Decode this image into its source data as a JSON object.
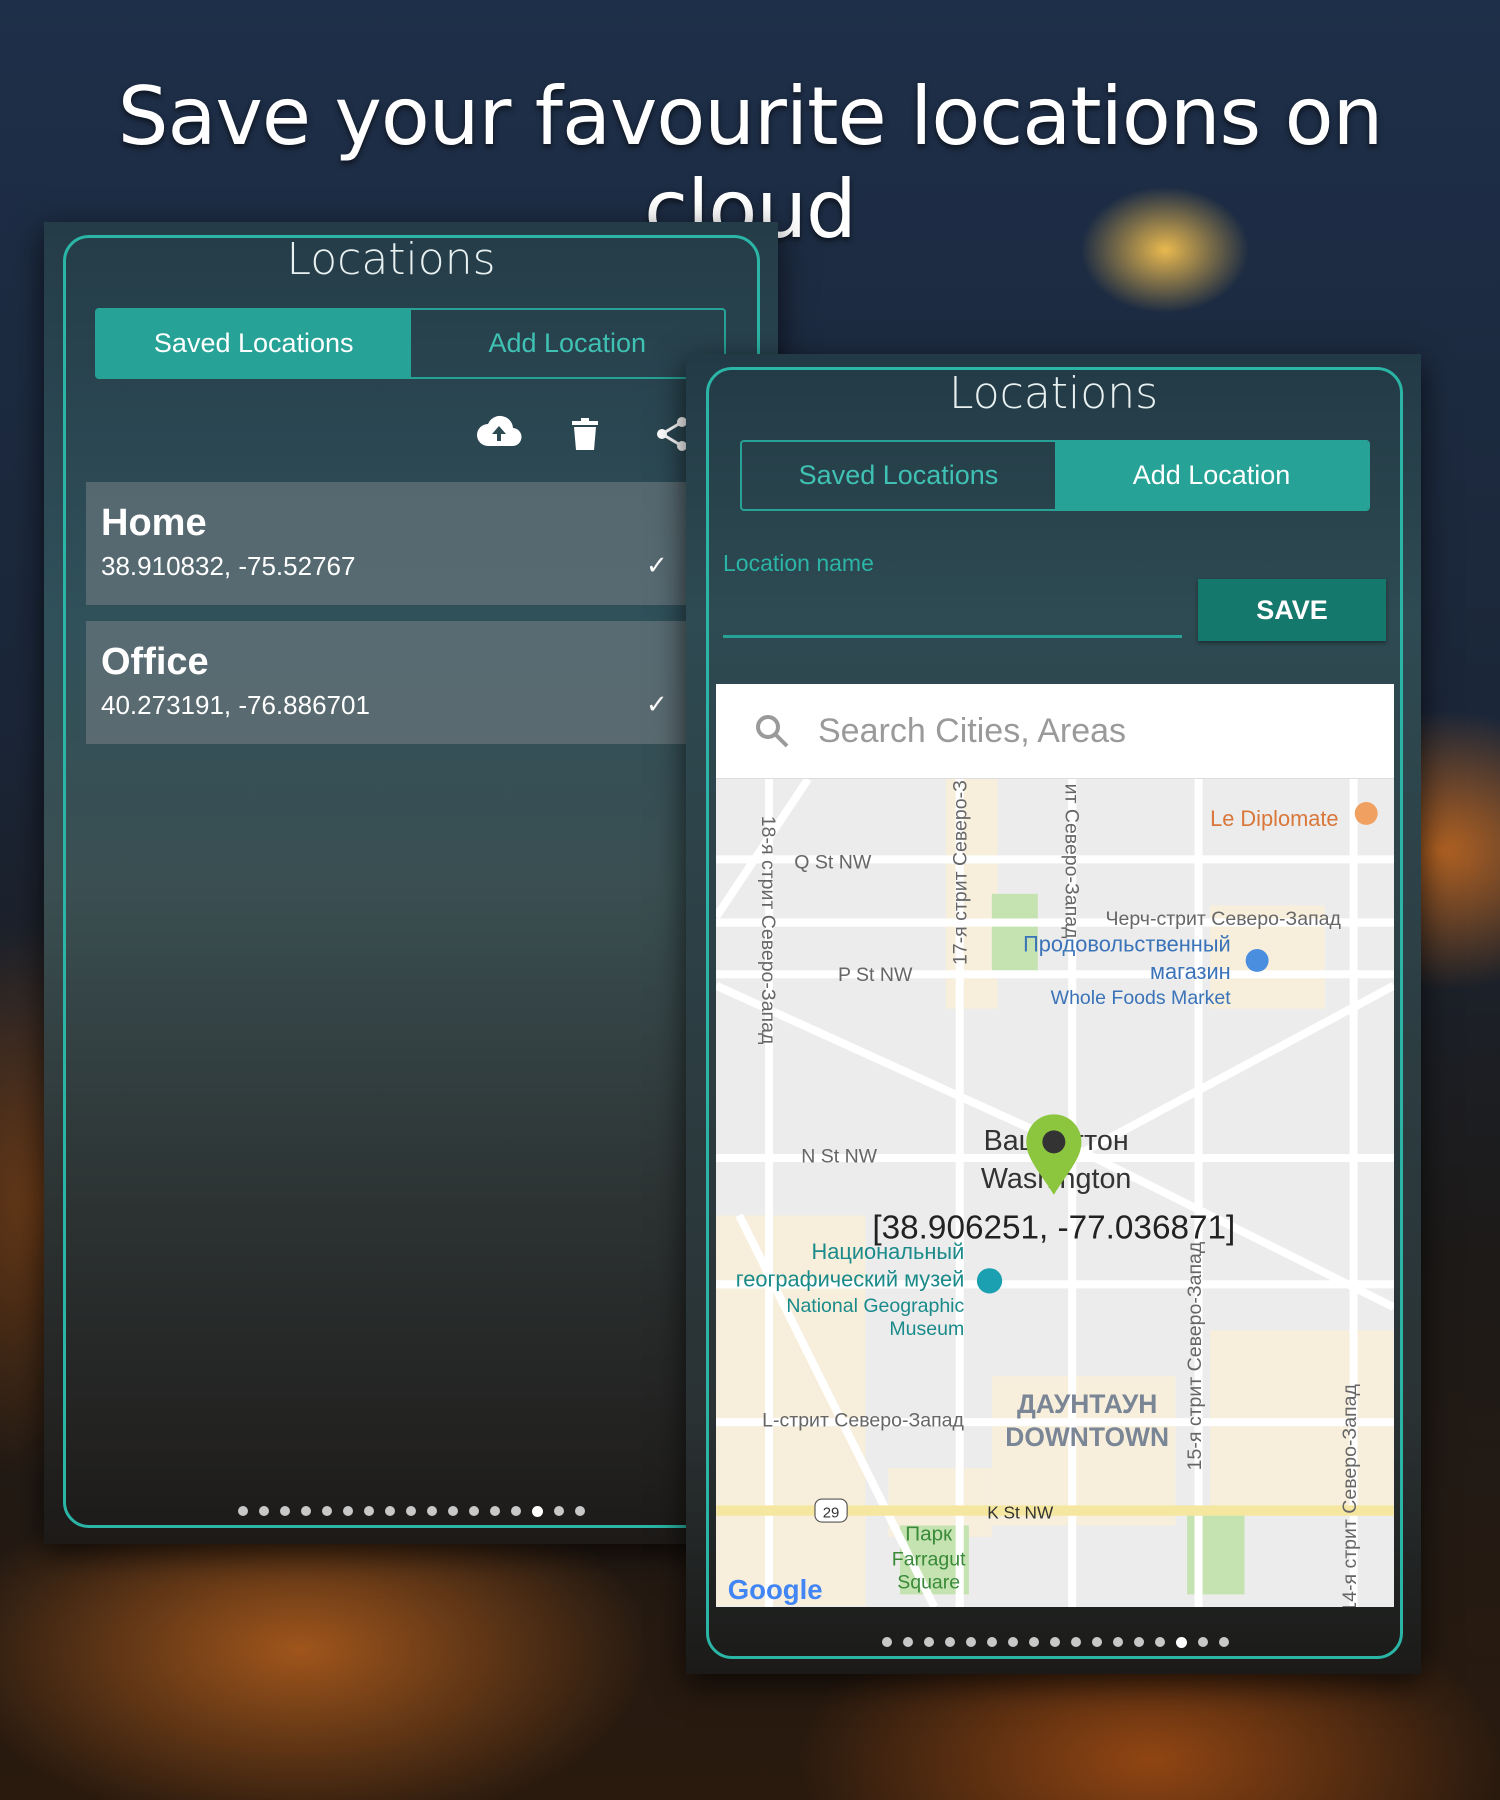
{
  "headline": "Save your favourite locations on cloud",
  "colors": {
    "accent": "#26a396",
    "pin": "#8cc63f",
    "save_button": "#15786c"
  },
  "left_screen": {
    "title": "Locations",
    "tabs": [
      {
        "label": "Saved Locations",
        "active": true
      },
      {
        "label": "Add Location",
        "active": false
      }
    ],
    "toolbar_icons": [
      "cloud-upload-icon",
      "trash-icon",
      "share-icon"
    ],
    "locations": [
      {
        "name": "Home",
        "coords": "38.910832, -75.52767"
      },
      {
        "name": "Office",
        "coords": "40.273191, -76.886701"
      }
    ],
    "page_dots": {
      "count": 17,
      "active": 15
    }
  },
  "right_screen": {
    "title": "Locations",
    "tabs": [
      {
        "label": "Saved Locations",
        "active": false
      },
      {
        "label": "Add Location",
        "active": true
      }
    ],
    "location_name_label": "Location name",
    "location_name_value": "",
    "save_label": "SAVE",
    "search_placeholder": "Search Cities, Areas",
    "map": {
      "selected_coords": "[38.906251, -77.036871]",
      "labels": {
        "le_diplomate": "Le Diplomate",
        "q_st": "Q St NW",
        "p_st": "P St NW",
        "n_st": "N St NW",
        "st18": "18-я стрит Северо-Запад",
        "st17": "17-я стрит Северо-З",
        "st16": "ит Северо-Запад",
        "church": "Черч-стрит Северо-Запад",
        "store_ru1": "Продовольственный",
        "store_ru2": "магазин",
        "store_en": "Whole Foods Market",
        "city_ru": "Вашингтон",
        "city_en": "Washington",
        "museum_ru1": "Национальный",
        "museum_ru2": "географический музей",
        "museum_en1": "National Geographic",
        "museum_en2": "Museum",
        "st15": "15-я стрит Северо-Запад",
        "l_st": "L-стрит Северо-Запад",
        "downtown_ru": "ДАУНТАУН",
        "downtown_en": "DOWNTOWN",
        "st14": "14-я стрит Северо-Запад",
        "k_st": "K St NW",
        "route": "29",
        "park1": "Парк",
        "park2": "Farragut",
        "park3": "Square",
        "google": "Google"
      }
    },
    "page_dots": {
      "count": 17,
      "active": 15
    }
  }
}
